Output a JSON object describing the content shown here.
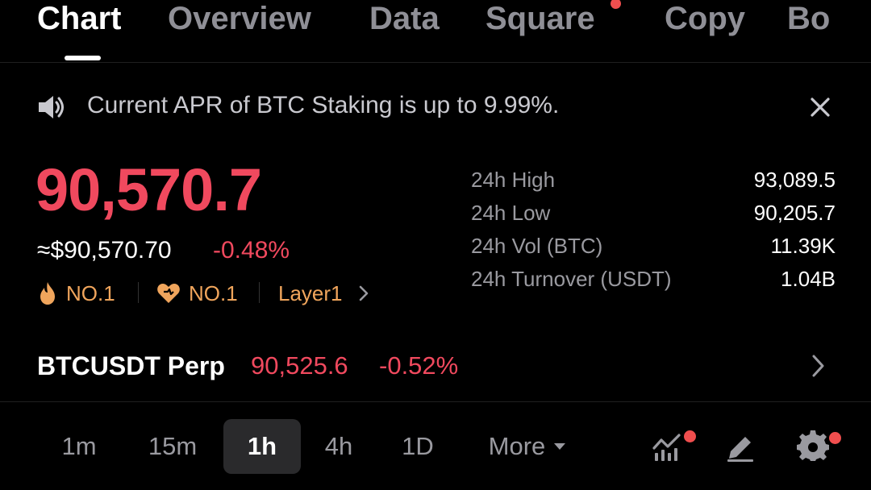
{
  "tabs": [
    {
      "label": "Chart",
      "active": true
    },
    {
      "label": "Overview",
      "active": false
    },
    {
      "label": "Data",
      "active": false
    },
    {
      "label": "Square",
      "active": false,
      "has_dot": true
    },
    {
      "label": "Copy",
      "active": false
    },
    {
      "label": "Bo",
      "active": false
    }
  ],
  "announcement": {
    "icon": "speaker-icon",
    "text": "Current APR of BTC Staking is up to 9.99%.",
    "close_icon": "close-icon"
  },
  "price": {
    "last": "90,570.7",
    "fiat": "≈$90,570.70",
    "change": "-0.48%"
  },
  "tags": [
    {
      "icon": "flame-icon",
      "label": "NO.1"
    },
    {
      "icon": "heart-icon",
      "label": "NO.1"
    },
    {
      "icon": "chevron-right-icon",
      "label": "Layer1"
    }
  ],
  "stats": [
    {
      "label": "24h High",
      "value": "93,089.5"
    },
    {
      "label": "24h Low",
      "value": "90,205.7"
    },
    {
      "label": "24h Vol (BTC)",
      "value": "11.39K"
    },
    {
      "label": "24h Turnover (USDT)",
      "value": "1.04B"
    }
  ],
  "perp": {
    "name": "BTCUSDT Perp",
    "price": "90,525.6",
    "change": "-0.52%"
  },
  "intervals": {
    "items": [
      "1m",
      "15m",
      "1h",
      "4h",
      "1D"
    ],
    "active": "1h",
    "more_label": "More"
  },
  "colors": {
    "background": "#000000",
    "negative": "#f0495e",
    "tag": "#f0a55c",
    "notification_dot": "#f04e4e",
    "muted_text": "#9a9aa0"
  }
}
